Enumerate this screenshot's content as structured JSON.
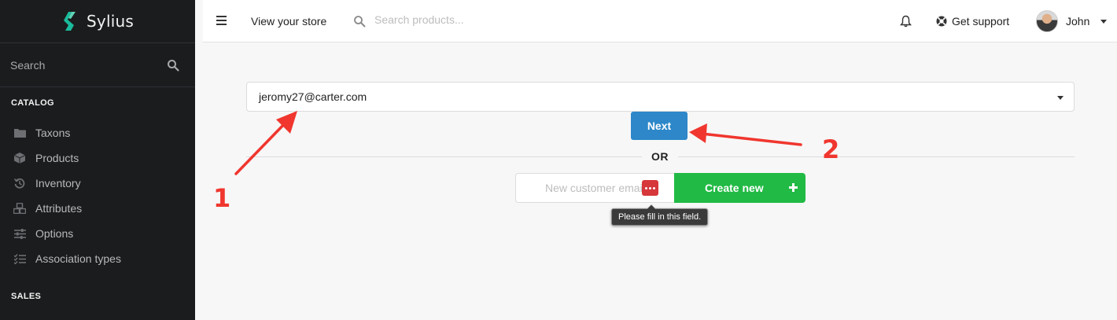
{
  "sidebar": {
    "brand": "Sylius",
    "search_label": "Search",
    "catalog_header": "CATALOG",
    "items": [
      {
        "label": "Taxons",
        "icon": "folder-icon"
      },
      {
        "label": "Products",
        "icon": "cube-icon"
      },
      {
        "label": "Inventory",
        "icon": "history-icon"
      },
      {
        "label": "Attributes",
        "icon": "cubes-icon"
      },
      {
        "label": "Options",
        "icon": "sliders-icon"
      },
      {
        "label": "Association types",
        "icon": "tasks-icon"
      }
    ],
    "sales_header": "SALES"
  },
  "topbar": {
    "view_store": "View your store",
    "search_placeholder": "Search products...",
    "support_label": "Get support",
    "user_name": "John"
  },
  "form": {
    "selected_customer": "jeromy27@carter.com",
    "next_label": "Next",
    "or_label": "OR",
    "new_email_placeholder": "New customer email",
    "create_label": "Create new",
    "validation_tooltip": "Please fill in this field."
  },
  "annotations": {
    "marker_1": "1",
    "marker_2": "2",
    "color": "#f0362e"
  },
  "colors": {
    "sidebar_bg": "#1b1c1d",
    "primary_blue": "#2d87c9",
    "create_green": "#21ba45",
    "brand_teal": "#1abb9c"
  }
}
